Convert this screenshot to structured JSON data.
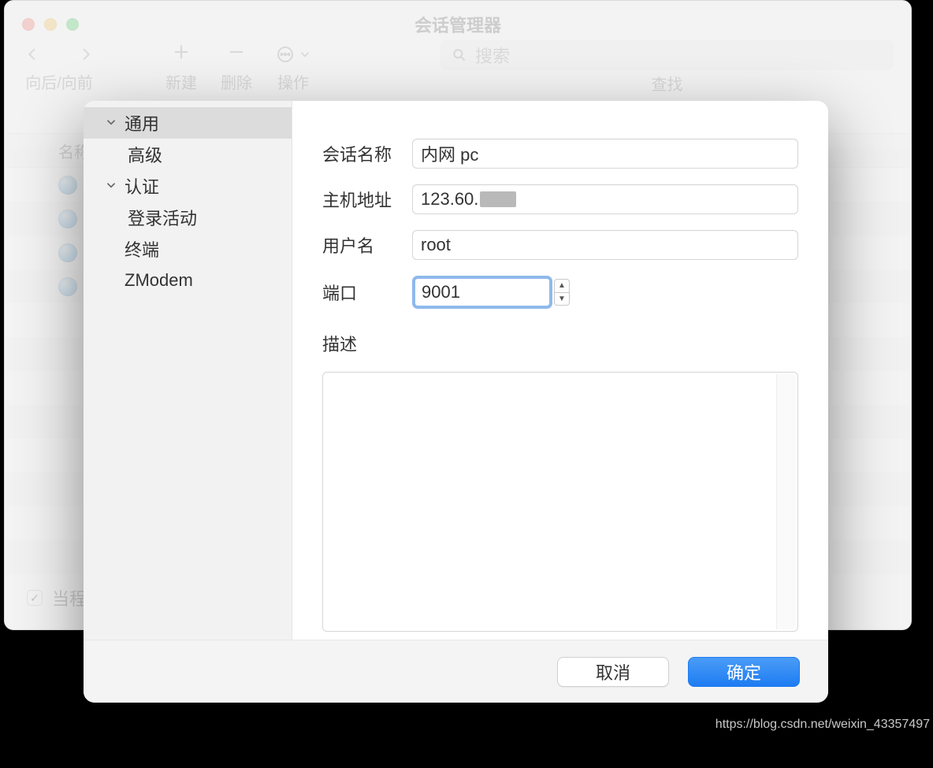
{
  "window": {
    "title": "会话管理器",
    "toolbar": {
      "nav_label": "向后/向前",
      "new_label": "新建",
      "delete_label": "删除",
      "action_label": "操作",
      "search_label": "查找",
      "search_placeholder": "搜索"
    },
    "column_header": "名称",
    "footer_checkbox_label": "当程"
  },
  "dialog": {
    "sidebar": {
      "items": [
        {
          "label": "通用",
          "expandable": true,
          "selected": true,
          "level": 1
        },
        {
          "label": "高级",
          "expandable": false,
          "level": 2
        },
        {
          "label": "认证",
          "expandable": true,
          "level": 1
        },
        {
          "label": "登录活动",
          "expandable": false,
          "level": 2
        },
        {
          "label": "终端",
          "expandable": false,
          "level": 1
        },
        {
          "label": "ZModem",
          "expandable": false,
          "level": 1
        }
      ]
    },
    "form": {
      "session_name": {
        "label": "会话名称",
        "value": "内网 pc"
      },
      "host": {
        "label": "主机地址",
        "value": "123.60."
      },
      "username": {
        "label": "用户名",
        "value": "root"
      },
      "port": {
        "label": "端口",
        "value": "9001"
      },
      "description": {
        "label": "描述",
        "value": ""
      }
    },
    "buttons": {
      "cancel": "取消",
      "ok": "确定"
    }
  },
  "watermark": "https://blog.csdn.net/weixin_43357497"
}
